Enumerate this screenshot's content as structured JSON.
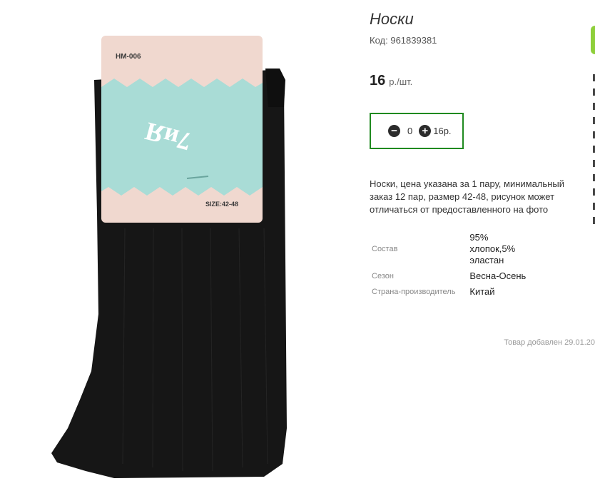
{
  "product": {
    "title": "Носки",
    "code_label": "Код:",
    "code_value": "961839381",
    "price_value": "16",
    "price_unit": "р./шт.",
    "description": "Носки, цена указана за 1 пару, минимальный заказ 12 пар, размер 42-48, рисунок может отличаться от предоставленного на фото",
    "added_text": "Товар добавлен 29.01.20"
  },
  "cart": {
    "minus_icon": "minus-circle-icon",
    "plus_icon": "plus-circle-icon",
    "quantity": "0",
    "sum": "16р."
  },
  "properties": [
    {
      "label": "Состав",
      "value": "95% хлопок,5% эластан"
    },
    {
      "label": "Сезон",
      "value": "Весна-Осень"
    },
    {
      "label": "Страна-производитель",
      "value": "Китай"
    }
  ],
  "photo": {
    "tag_model": "HM-006",
    "tag_brand": "7иЯ",
    "tag_size": "SIZE:42-48"
  },
  "colors": {
    "accent_green": "#1f8a1f",
    "sock_black": "#161616",
    "tag_pink": "#f0d8cf",
    "tag_mint": "#a9dcd6"
  }
}
